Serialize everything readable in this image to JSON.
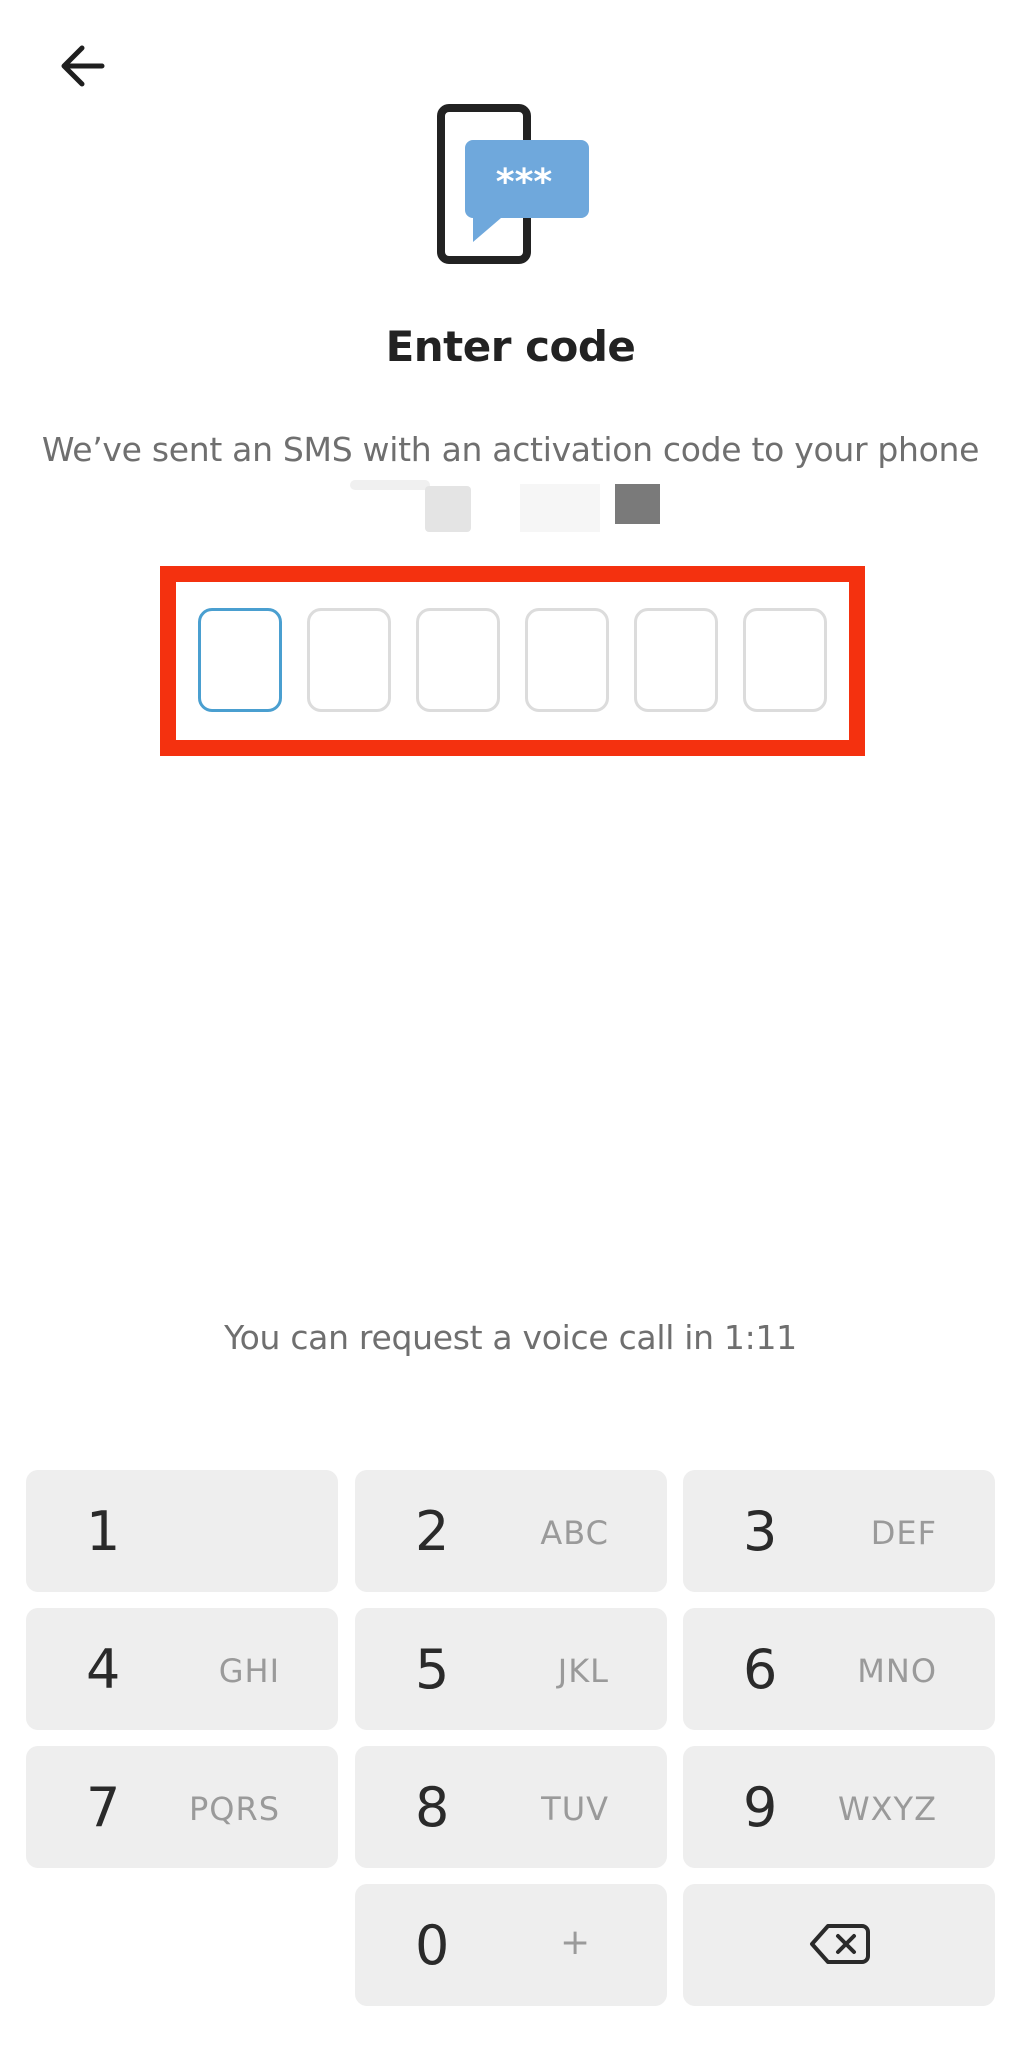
{
  "header": {
    "back_icon": "arrow-left-icon"
  },
  "hero": {
    "icon": "phone-sms-icon",
    "bubble_text": "***",
    "bubble_color": "#6fa8dc"
  },
  "title": "Enter code",
  "subtitle": "We’ve sent an SMS with an activation code to your phone",
  "code_input": {
    "length": 6,
    "active_index": 0,
    "frame_color": "#f4310f",
    "active_color": "#4a9fd0"
  },
  "voice_call_note": "You can request a voice call in 1:11",
  "keypad": {
    "keys": [
      {
        "digit": "1",
        "letters": ""
      },
      {
        "digit": "2",
        "letters": "ABC"
      },
      {
        "digit": "3",
        "letters": "DEF"
      },
      {
        "digit": "4",
        "letters": "GHI"
      },
      {
        "digit": "5",
        "letters": "JKL"
      },
      {
        "digit": "6",
        "letters": "MNO"
      },
      {
        "digit": "7",
        "letters": "PQRS"
      },
      {
        "digit": "8",
        "letters": "TUV"
      },
      {
        "digit": "9",
        "letters": "WXYZ"
      },
      {
        "digit": "0",
        "letters": "+"
      }
    ],
    "backspace_icon": "backspace-icon"
  }
}
